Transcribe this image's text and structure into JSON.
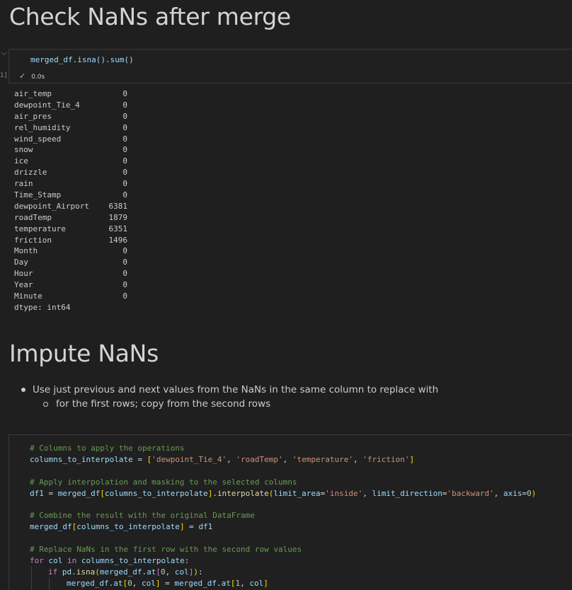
{
  "headings": {
    "check": "Check NaNs after merge",
    "impute": "Impute NaNs"
  },
  "cell1": {
    "exec_count": "1]",
    "code": "merged_df.isna().sum()",
    "status_time": "0.0s"
  },
  "output": {
    "rows": [
      {
        "name": "air_temp",
        "value": "0"
      },
      {
        "name": "dewpoint_Tie_4",
        "value": "0"
      },
      {
        "name": "air_pres",
        "value": "0"
      },
      {
        "name": "rel_humidity",
        "value": "0"
      },
      {
        "name": "wind_speed",
        "value": "0"
      },
      {
        "name": "snow",
        "value": "0"
      },
      {
        "name": "ice",
        "value": "0"
      },
      {
        "name": "drizzle",
        "value": "0"
      },
      {
        "name": "rain",
        "value": "0"
      },
      {
        "name": "Time_Stamp",
        "value": "0"
      },
      {
        "name": "dewpoint_Airport",
        "value": "6381"
      },
      {
        "name": "roadTemp",
        "value": "1879"
      },
      {
        "name": "temperature",
        "value": "6351"
      },
      {
        "name": "friction",
        "value": "1496"
      },
      {
        "name": "Month",
        "value": "0"
      },
      {
        "name": "Day",
        "value": "0"
      },
      {
        "name": "Hour",
        "value": "0"
      },
      {
        "name": "Year",
        "value": "0"
      },
      {
        "name": "Minute",
        "value": "0"
      }
    ],
    "dtype": "dtype: int64"
  },
  "bullets": {
    "main": "Use just previous and next values from the NaNs in the same column to replace with",
    "sub": "for the first rows; copy from the second rows"
  },
  "cell2": {
    "comment1": "# Columns to apply the operations",
    "line2": {
      "var": "columns_to_interpolate",
      "eq": " = ",
      "lb": "[",
      "s1": "'dewpoint_Tie_4'",
      "s2": "'roadTemp'",
      "s3": "'temperature'",
      "s4": "'friction'",
      "rb": "]",
      "sep": ", "
    },
    "comment2": "# Apply interpolation and masking to the selected columns",
    "line4": {
      "a": "df1",
      "b": " = ",
      "c": "merged_df",
      "d": "[",
      "e": "columns_to_interpolate",
      "f": "]",
      "g": ".",
      "h": "interpolate",
      "i": "(",
      "j": "limit_area",
      "k": "=",
      "l": "'inside'",
      "m": ", ",
      "n": "limit_direction",
      "o": "=",
      "p": "'backward'",
      "q": ", ",
      "r": "axis",
      "s": "=",
      "t": "0",
      "u": ")"
    },
    "comment3": "# Combine the result with the original DataFrame",
    "line6": {
      "a": "merged_df",
      "b": "[",
      "c": "columns_to_interpolate",
      "d": "]",
      "e": " = ",
      "f": "df1"
    },
    "comment4": "# Replace NaNs in the first row with the second row values",
    "line8": {
      "a": "for",
      "b": " ",
      "c": "col",
      "d": " ",
      "e": "in",
      "f": " ",
      "g": "columns_to_interpolate",
      "h": ":"
    },
    "line9": {
      "a": "if",
      "b": " ",
      "c": "pd",
      "d": ".",
      "e": "isna",
      "f": "(",
      "g": "merged_df",
      "h": ".",
      "i": "at",
      "j": "[",
      "k": "0",
      "l": ", ",
      "m": "col",
      "n": "]",
      "o": ")",
      "p": ":"
    },
    "line10": {
      "a": "merged_df",
      "b": ".",
      "c": "at",
      "d": "[",
      "e": "0",
      "f": ", ",
      "g": "col",
      "h": "]",
      "i": " = ",
      "j": "merged_df",
      "k": ".",
      "l": "at",
      "m": "[",
      "n": "1",
      "o": ", ",
      "p": "col",
      "q": "]"
    }
  }
}
